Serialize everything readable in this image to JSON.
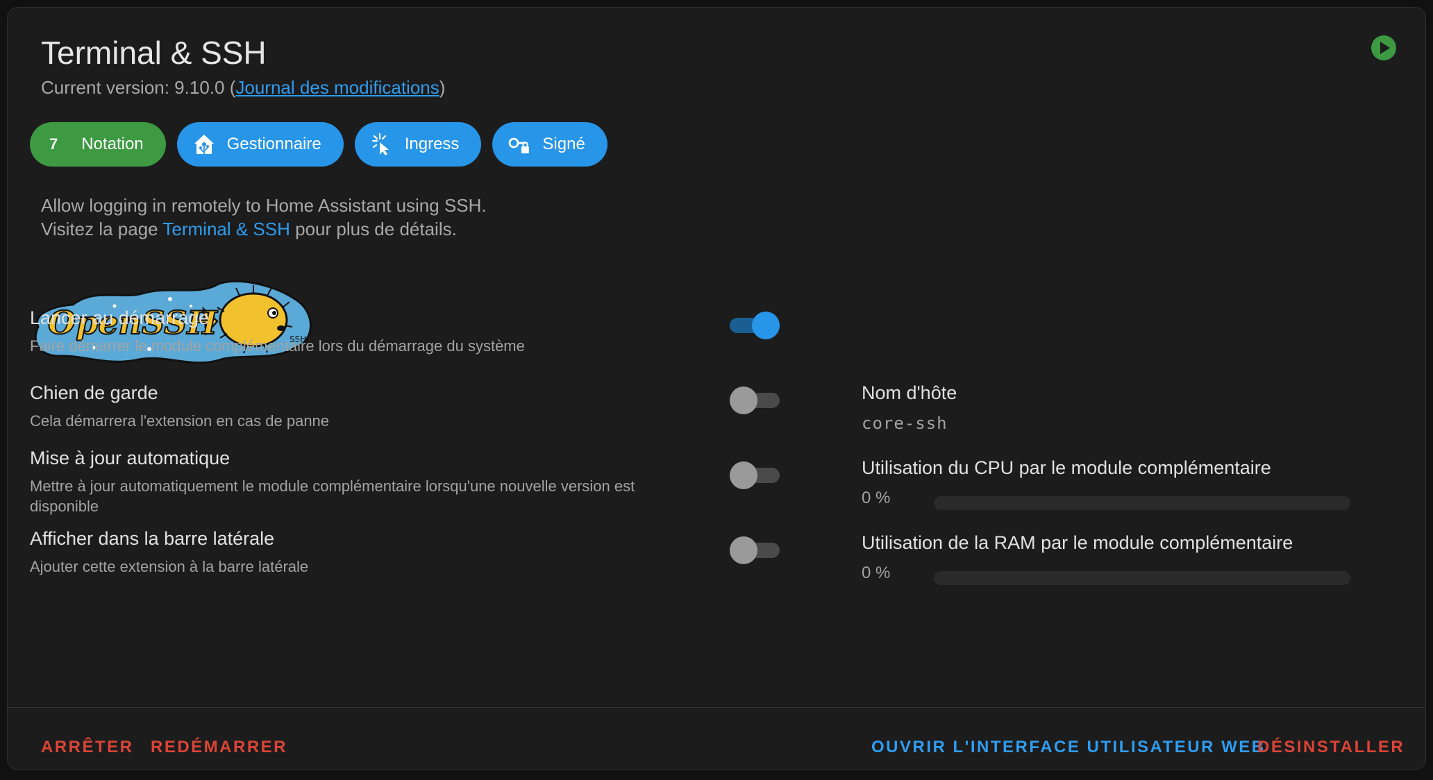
{
  "header": {
    "title": "Terminal & SSH",
    "version_prefix": "Current version: 9.10.0 (",
    "changelog_link": "Journal des modifications",
    "version_suffix": ")"
  },
  "status_icon": "play-circle-icon",
  "colors": {
    "accent": "#2795e8",
    "success": "#3d9a42",
    "danger": "#db4437",
    "background": "#1c1c1c"
  },
  "chips": [
    {
      "icon": "",
      "number": "7",
      "label": "Notation",
      "color": "#3d9a42"
    },
    {
      "icon": "home-assistant-icon",
      "label": "Gestionnaire",
      "color": "#2795e8"
    },
    {
      "icon": "cursor-click-icon",
      "label": "Ingress",
      "color": "#2795e8"
    },
    {
      "icon": "key-lock-icon",
      "label": "Signé",
      "color": "#2795e8"
    }
  ],
  "description": {
    "line1": "Allow logging in remotely to Home Assistant using SSH.",
    "line2_prefix": "Visitez la page ",
    "line2_link": "Terminal & SSH",
    "line2_suffix": " pour plus de détails."
  },
  "logo_text": "OpenSSH",
  "options": [
    {
      "label": "Lancer au démarrage",
      "subtitle": "Faire démarrer le module complémentaire lors du démarrage du système",
      "enabled": true
    },
    {
      "label": "Chien de garde",
      "subtitle": "Cela démarrera l'extension en cas de panne",
      "enabled": false
    },
    {
      "label": "Mise à jour automatique",
      "subtitle": "Mettre à jour automatiquement le module complémentaire lorsqu'une nouvelle version est disponible",
      "enabled": false
    },
    {
      "label": "Afficher dans la barre latérale",
      "subtitle": "Ajouter cette extension à la barre latérale",
      "enabled": false
    }
  ],
  "stats": {
    "hostname": {
      "label": "Nom d'hôte",
      "value": "core-ssh"
    },
    "cpu": {
      "label": "Utilisation du CPU par le module complémentaire",
      "value": "0 %",
      "percent": 0
    },
    "ram": {
      "label": "Utilisation de la RAM par le module complémentaire",
      "value": "0 %",
      "percent": 0
    }
  },
  "actions": {
    "stop": "ARRÊTER",
    "restart": "REDÉMARRER",
    "open_web_ui": "OUVRIR L'INTERFACE UTILISATEUR WEB",
    "uninstall": "DÉSINSTALLER"
  }
}
